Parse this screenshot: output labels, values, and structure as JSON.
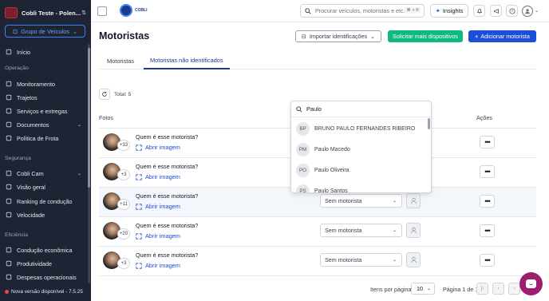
{
  "sidebar": {
    "company": "Cobli Teste - Polen...",
    "group_button": "Grupo de Veículos",
    "items": [
      {
        "label": "Início",
        "icon": "home-icon"
      },
      {
        "section": "Operação"
      },
      {
        "label": "Monitoramento",
        "icon": "monitor-icon"
      },
      {
        "label": "Trajetos",
        "icon": "route-icon"
      },
      {
        "label": "Serviços e entregas",
        "icon": "services-icon"
      },
      {
        "label": "Documentos",
        "icon": "documents-icon",
        "expand": true
      },
      {
        "label": "Política de Frota",
        "icon": "policy-icon"
      },
      {
        "section": "Segurança"
      },
      {
        "label": "Cobli Cam",
        "icon": "camera-icon",
        "expand": true
      },
      {
        "label": "Visão geral",
        "icon": "overview-icon"
      },
      {
        "label": "Ranking de condução",
        "icon": "ranking-icon"
      },
      {
        "label": "Velocidade",
        "icon": "speed-icon"
      },
      {
        "section": "Eficiência"
      },
      {
        "label": "Condução econômica",
        "icon": "eco-icon"
      },
      {
        "label": "Produtividade",
        "icon": "productivity-icon"
      },
      {
        "label": "Despesas operacionais",
        "icon": "expenses-icon"
      }
    ],
    "version": "Nova versão disponível - 7.5.25"
  },
  "topbar": {
    "logo_text": "COBLI",
    "search_placeholder": "Procurar veículos, motoristas e etc...",
    "search_shortcut": "⌘ + K",
    "insights_label": "Insights"
  },
  "page": {
    "title": "Motoristas",
    "import_button": "Importar identificações",
    "request_button": "Solicitar mais dispositivos",
    "add_button": "Adicionar motorista",
    "tabs": [
      "Motoristas",
      "Motoristas não identificados"
    ],
    "active_tab": 1,
    "total": "Total: 5",
    "col_photos": "Fotos",
    "col_actions": "Ações"
  },
  "rows": [
    {
      "count": "+33",
      "question": "Quem é esse motorista?",
      "expand": "Abrir imagem",
      "driver": "",
      "highlight": false
    },
    {
      "count": "+3",
      "question": "Quem é esse motorista?",
      "expand": "Abrir imagem",
      "driver": "",
      "highlight": false
    },
    {
      "count": "+11",
      "question": "Quem é esse motorista?",
      "expand": "Abrir imagem",
      "driver": "Sem motorista",
      "highlight": true
    },
    {
      "count": "+20",
      "question": "Quem é esse motorista?",
      "expand": "Abrir imagem",
      "driver": "Sem motorista",
      "highlight": false
    },
    {
      "count": "+3",
      "question": "Quem é esse motorista?",
      "expand": "Abrir imagem",
      "driver": "Sem motorista",
      "highlight": false
    }
  ],
  "dropdown": {
    "query": "Paulo",
    "options": [
      {
        "initials": "BP",
        "name": "BRUNO PAULO FERNANDES RIBEIRO"
      },
      {
        "initials": "PM",
        "name": "Paulo Macedo"
      },
      {
        "initials": "PO",
        "name": "Paulo Oliveira"
      },
      {
        "initials": "PS",
        "name": "Paulo Santos"
      }
    ]
  },
  "pagination": {
    "per_page_label": "Itens por página",
    "per_page": "10",
    "page_info": "Página 1 de 1"
  }
}
